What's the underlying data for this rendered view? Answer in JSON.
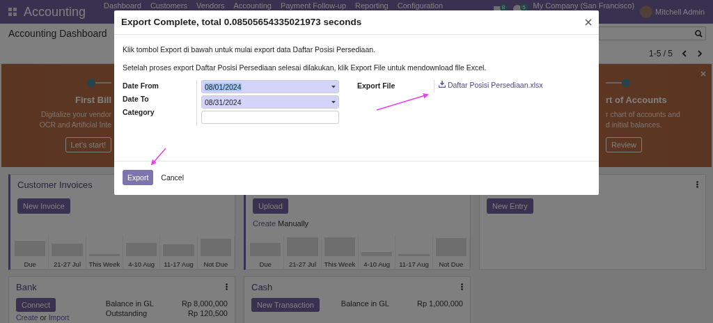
{
  "navbar": {
    "app_name": "Accounting",
    "menu": [
      "Dashboard",
      "Customers",
      "Vendors",
      "Accounting",
      "Payment Follow-up",
      "Reporting",
      "Configuration"
    ],
    "badges": [
      "8",
      "5"
    ],
    "company": "My Company (San Francisco)",
    "user": "Mitchell Admin"
  },
  "control_panel": {
    "title": "Accounting Dashboard",
    "pager": "1-5 / 5"
  },
  "banner": {
    "steps": [
      {
        "title": "First Bill",
        "lines": [
          "Digitalize your vendor",
          "OCR and Artificial Inte"
        ],
        "button": "Let's start!"
      },
      {
        "title": "rt of Accounts",
        "lines": [
          "r chart of accounts and",
          "d initial balances."
        ],
        "button": "Review"
      }
    ]
  },
  "cards": [
    {
      "kind": "chart",
      "title": "Customer Invoices",
      "accent": true,
      "menu": false,
      "button": "New Invoice",
      "bar_labels": [
        "Due",
        "21-27 Jul",
        "This Week",
        "4-10 Aug",
        "11-17 Aug",
        "Not Due"
      ]
    },
    {
      "kind": "chart",
      "accent": true,
      "menu": false,
      "button": "Upload",
      "create_link": "Create",
      "create_text": "Manually",
      "bar_labels": [
        "Due",
        "21-27 Jul",
        "This Week",
        "4-10 Aug",
        "11-17 Aug",
        "Not Due"
      ]
    },
    {
      "kind": "plain",
      "accent": false,
      "menu": true,
      "button": "New Entry"
    },
    {
      "kind": "balance",
      "title": "Bank",
      "accent": false,
      "menu": true,
      "button": "Connect",
      "balances": [
        {
          "label": "Balance in GL",
          "value": "Rp 8,000,000"
        },
        {
          "label": "Outstanding",
          "value": "Rp 120,500"
        }
      ],
      "footer": {
        "link_1": "Create",
        "text": "or",
        "link_2": "Import"
      }
    },
    {
      "kind": "balance",
      "title": "Cash",
      "accent": false,
      "menu": true,
      "button": "New Transaction",
      "balances": [
        {
          "label": "Balance in GL",
          "value": "Rp 1,000,000"
        }
      ]
    }
  ],
  "dialog": {
    "title": "Export Complete, total 0.08505654335021973 seconds",
    "messages": [
      "Klik tombol Export di bawah untuk mulai export data Daftar Posisi Persediaan.",
      "Setelah proses export Daftar Posisi Persediaan selesai dilakukan, klik Export File untuk mendownload file Excel."
    ],
    "fields": [
      {
        "label": "Date From",
        "kind": "date",
        "value": "08/01/2024",
        "text_selected": true
      },
      {
        "label": "Date To",
        "kind": "date",
        "value": "08/31/2024",
        "text_selected": false
      },
      {
        "label": "Category",
        "kind": "text"
      }
    ],
    "export_file": {
      "label": "Export File",
      "file": "Daftar Posisi Persediaan.xlsx"
    },
    "buttons": [
      {
        "label": "Export",
        "primary": true
      },
      {
        "label": "Cancel",
        "primary": false
      }
    ]
  }
}
